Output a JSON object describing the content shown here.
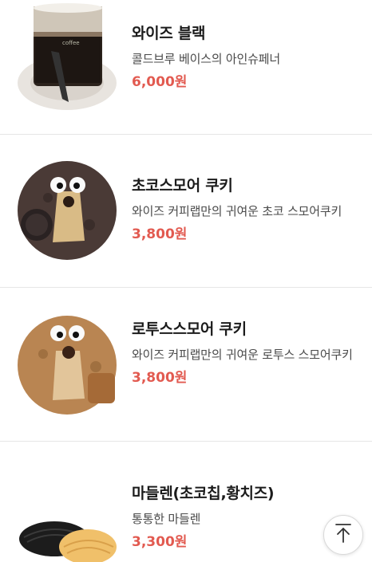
{
  "menu": {
    "items": [
      {
        "name": "와이즈 블랙",
        "description": "콜드브루 베이스의 아인슈페너",
        "price": "6,000원",
        "image_icon": "iced-coffee-glass"
      },
      {
        "name": "초코스모어 쿠키",
        "description": "와이즈 커피랩만의 귀여운 초코 스모어쿠키",
        "price": "3,800원",
        "image_icon": "choco-smore-cookie"
      },
      {
        "name": "로투스스모어 쿠키",
        "description": "와이즈 커피랩만의 귀여운 로투스 스모어쿠키",
        "price": "3,800원",
        "image_icon": "lotus-smore-cookie"
      },
      {
        "name": "마들렌(초코칩,황치즈)",
        "description": "통통한 마들렌",
        "price": "3,300원",
        "image_icon": "madeleines"
      }
    ]
  },
  "scroll_top_button": {
    "icon": "arrow-up-icon"
  },
  "colors": {
    "price": "#e25a50",
    "divider": "#e6e6e6"
  }
}
